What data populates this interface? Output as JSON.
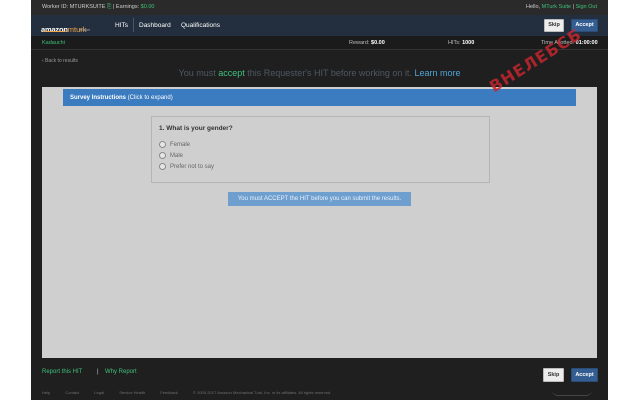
{
  "topstrip": {
    "worker_label": "Worker ID: MTURKSUITE",
    "copy_icon": "copy-icon",
    "earnings_label": "| Earnings:",
    "earnings_value": "$0.00",
    "hello_label": "Hello,",
    "user_name": "MTurk Suite",
    "separator": "|",
    "sign_out": "Sign Out"
  },
  "navbar": {
    "logo_amazon": "amazon",
    "logo_mturk": "mturk",
    "logo_worker": "Worker",
    "links": [
      "HITs",
      "Dashboard",
      "Qualifications"
    ],
    "skip_label": "Skip",
    "accept_label": "Accept"
  },
  "infobar": {
    "requester": "Kadauchi",
    "reward_label": "Reward:",
    "reward_value": "$0.00",
    "hits_label": "HITs:",
    "hits_value": "1000",
    "time_label": "Time Allotted:",
    "time_value": "01:00:00"
  },
  "back_link": "‹ Back to results",
  "accept_message": {
    "part1": "You must",
    "accept": "accept",
    "part2": "this Requester's HIT before working on it.",
    "learn_more": "Learn more"
  },
  "watermark": "ВНЕЛЕБСБ",
  "instructions": {
    "title": "Survey Instructions",
    "hint": "(Click to expand)"
  },
  "question": {
    "title": "1. What is your gender?",
    "options": [
      "Female",
      "Male",
      "Prefer not to say"
    ]
  },
  "submit_notice": "You must ACCEPT the HIT before you can submit the results.",
  "bottom": {
    "report": "Report this HIT",
    "separator": "|",
    "why_report": "Why Report",
    "skip_label": "Skip",
    "accept_label": "Accept"
  },
  "footer": {
    "links": [
      "Help",
      "Contact",
      "Legal",
      "Service Health",
      "Feedback"
    ],
    "copyright": "© 2005-2017 Amazon Mechanical Turk, Inc. or its affiliates. All rights reserved."
  },
  "colors": {
    "accent_green": "#3ec17a",
    "nav_bg": "#232f3e",
    "instr_blue": "#3b7bbf",
    "accept_blue": "#345e92"
  }
}
